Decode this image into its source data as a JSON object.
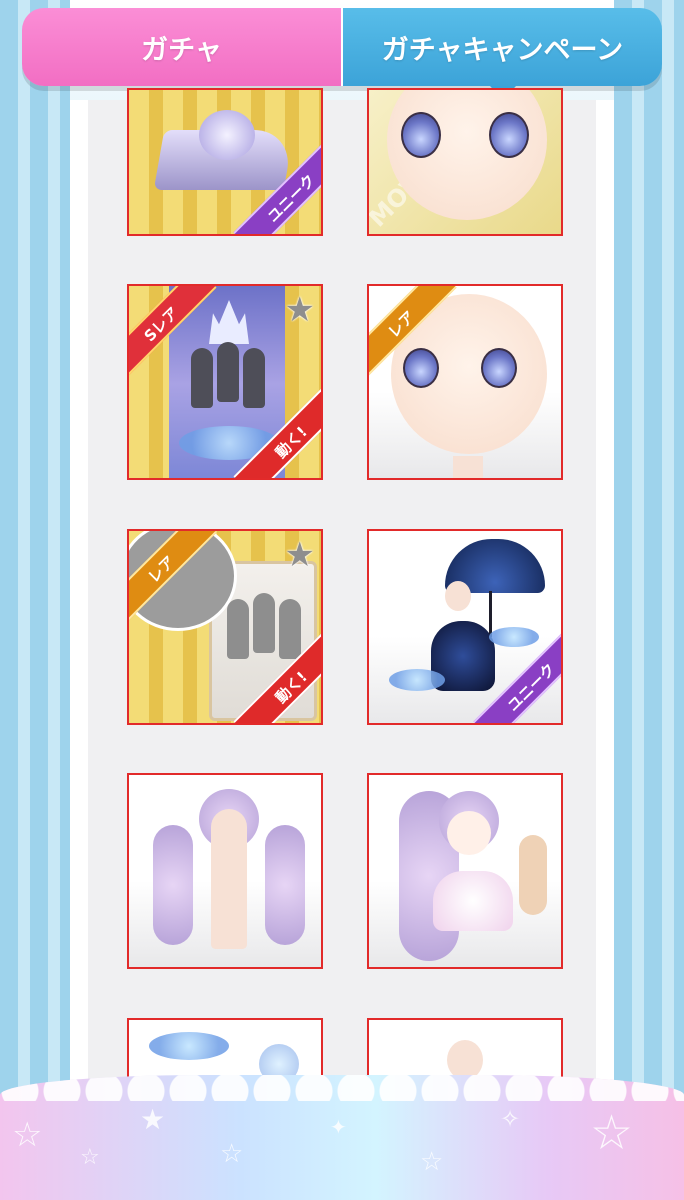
{
  "tabs": {
    "gacha_label": "ガチャ",
    "campaign_label": "ガチャキャンペーン",
    "active": "campaign"
  },
  "items": [
    {
      "top_ribbon": "",
      "bottom_ribbon": "ユニーク",
      "watermark": "",
      "star": false
    },
    {
      "top_ribbon": "",
      "bottom_ribbon": "",
      "watermark": "MOVE MOVE",
      "star": false
    },
    {
      "top_ribbon": "Sレア",
      "bottom_ribbon": "動く!",
      "watermark": "",
      "star": true
    },
    {
      "top_ribbon": "レア",
      "bottom_ribbon": "",
      "watermark": "",
      "star": false
    },
    {
      "top_ribbon": "レア",
      "bottom_ribbon": "動く!",
      "watermark": "",
      "star": true
    },
    {
      "top_ribbon": "",
      "bottom_ribbon": "ユニーク",
      "watermark": "",
      "star": false
    },
    {
      "top_ribbon": "",
      "bottom_ribbon": "",
      "watermark": "",
      "star": false
    },
    {
      "top_ribbon": "",
      "bottom_ribbon": "",
      "watermark": "",
      "star": false
    },
    {
      "top_ribbon": "",
      "bottom_ribbon": "",
      "watermark": "",
      "star": false
    },
    {
      "top_ribbon": "",
      "bottom_ribbon": "",
      "watermark": "",
      "star": false
    }
  ],
  "colors": {
    "tab_pink": "#f26ec3",
    "tab_blue": "#3ca3d8",
    "tile_border": "#e22a2a",
    "frame_blue": "#9ed3ec"
  },
  "icons": {
    "favorite": "star-icon",
    "footer_decor": "sparkle-star-icon"
  }
}
